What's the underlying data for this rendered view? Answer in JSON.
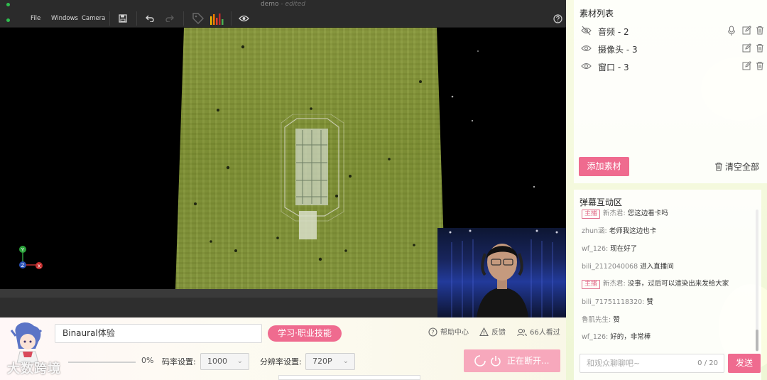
{
  "window": {
    "doc_name": "demo",
    "doc_state": "- edited"
  },
  "menu": [
    "File",
    "Windows",
    "Camera"
  ],
  "axis_gizmo": {
    "y": "Y",
    "z": "Z",
    "x": "X"
  },
  "stream": {
    "title": "Binaural体验",
    "category": "学习·职业技能",
    "help": "帮助中心",
    "feedback": "反馈",
    "viewers": "66人看过",
    "volume": "0%",
    "volume_level": 0,
    "bitrate_label": "码率设置:",
    "bitrate_value": "1000",
    "resolution_label": "分辨率设置:",
    "resolution_value": "720P",
    "live_button": "正在断开..."
  },
  "watermark": "大数跨境",
  "assets": {
    "title": "素材列表",
    "items": [
      {
        "name": "音频 - 2",
        "visible": false,
        "has_mic": true
      },
      {
        "name": "摄像头 - 3",
        "visible": true,
        "has_mic": false
      },
      {
        "name": "窗口 - 3",
        "visible": true,
        "has_mic": false
      }
    ],
    "add_button": "添加素材",
    "clear_button": "清空全部"
  },
  "chat": {
    "title": "弹幕互动区",
    "messages": [
      {
        "badge": "主播",
        "user": "新杰君:",
        "text": "您这边看卡吗"
      },
      {
        "badge": "",
        "user": "zhun涵:",
        "text": "老师我这边也卡"
      },
      {
        "badge": "",
        "user": "wf_126:",
        "text": "现在好了"
      },
      {
        "badge": "",
        "user": "bili_2112040068",
        "text": "进入直播间"
      },
      {
        "badge": "主播",
        "user": "新杰君:",
        "text": "没事，过后可以渲染出来发给大家"
      },
      {
        "badge": "",
        "user": "bili_71751118320:",
        "text": "赞"
      },
      {
        "badge": "",
        "user": "鲁肌先生:",
        "text": "赞"
      },
      {
        "badge": "",
        "user": "wf_126:",
        "text": "好的，非常棒"
      }
    ],
    "input_placeholder": "和观众聊聊吧~",
    "char_count": "0 / 20",
    "send_button": "发送"
  },
  "colors": {
    "accent": "#ef6b8f",
    "accent_disabled": "#f7a8bc",
    "toolbar": "#2b2b2b"
  }
}
